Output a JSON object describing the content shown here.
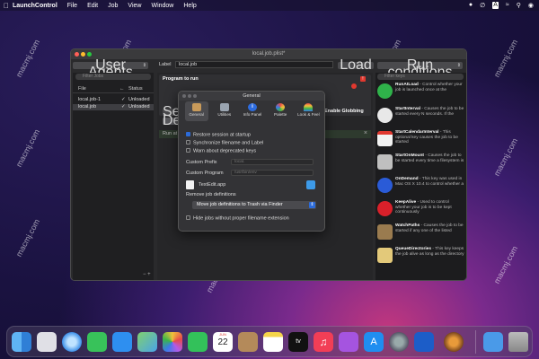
{
  "menubar": {
    "app_name": "LaunchControl",
    "menus": [
      "File",
      "Edit",
      "Job",
      "View",
      "Window",
      "Help"
    ]
  },
  "window": {
    "title": "local.job.plist*",
    "left": {
      "filter_label": "User Agents",
      "search_placeholder": "Filter Jobs",
      "col_file": "File",
      "col_status": "Status",
      "jobs": [
        {
          "name": "local.job-1",
          "status": "Unloaded",
          "checked": true
        },
        {
          "name": "local.job",
          "status": "Unloaded",
          "checked": true
        }
      ]
    },
    "center": {
      "label_label": "Label",
      "label_value": "local.job",
      "load_button": "Load",
      "program_label": "Program to run",
      "set_fragment": "Set",
      "default_fragment": "Defa",
      "enable_globbing": "Enable Globbing",
      "run_fragment": "Run at"
    },
    "right": {
      "run_conditions": "Run conditions",
      "filter_placeholder": "Filter keys",
      "items": [
        {
          "title": "RunAtLoad",
          "desc": " - Control whether your job is launched once at the"
        },
        {
          "title": "StartInterval",
          "desc": " - Causes the job to be started every N seconds. If the"
        },
        {
          "title": "StartCalendarInterval",
          "desc": " - This optional key causes the job to be started"
        },
        {
          "title": "StartOnMount",
          "desc": " - Causes the job to be started every time a filesystem is"
        },
        {
          "title": "OnDemand",
          "desc": " - This key was used in Mac OS X 10.4 to control whether a"
        },
        {
          "title": "KeepAlive",
          "desc": " - Used to control whether your job is to be kept continuously"
        },
        {
          "title": "WatchPaths",
          "desc": " - Causes the job to be started if any one of the listed"
        },
        {
          "title": "QueueDirectories",
          "desc": " - This key keeps the job alive as long as the directory"
        }
      ]
    }
  },
  "dialog": {
    "title": "General",
    "tabs": [
      "General",
      "Utilities",
      "Info Panel",
      "Palette",
      "Look & Feel"
    ],
    "options": [
      {
        "label": "Restore session at startup",
        "checked": true
      },
      {
        "label": "Synchronize filename and Label",
        "checked": false
      },
      {
        "label": "Warn about deprecated keys",
        "checked": false
      }
    ],
    "custom_prefix_label": "Custom Prefix",
    "custom_prefix_placeholder": "local.",
    "custom_program_label": "Custom Program",
    "custom_program_placeholder": "/usr/bin/env",
    "editor_app": "TextEdit.app",
    "remove_label": "Remove job definitions",
    "remove_option": "Move job definitions to Trash via Finder",
    "hide_option": "Hide jobs without proper filename extension"
  },
  "watermark": "macmj.com",
  "dock": {
    "apps": [
      "finder-icon",
      "launchpad-icon",
      "safari-icon",
      "messages-icon",
      "mail-icon",
      "maps-icon",
      "photos-icon",
      "facetime-icon",
      "calendar-icon",
      "contacts-icon",
      "notes-icon",
      "tv-icon",
      "music-icon",
      "podcasts-icon",
      "app-store-icon",
      "system-settings-icon",
      "testflight-icon",
      "launchcontrol-icon",
      "downloads-icon",
      "trash-icon"
    ],
    "calendar_month": "JUN",
    "calendar_day": "22"
  }
}
